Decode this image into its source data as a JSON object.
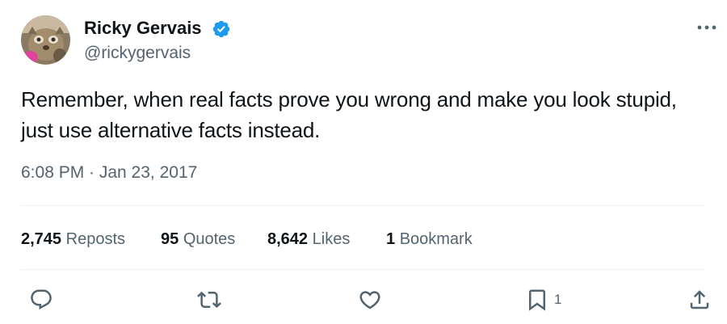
{
  "author": {
    "name": "Ricky Gervais",
    "handle": "@rickygervais",
    "verified_icon": "verified-badge-icon",
    "verified_color": "#1d9bf0"
  },
  "tweet": {
    "text_lines": [
      "Remember, when real facts prove you wrong and make you look stupid,",
      "just use alternative facts instead."
    ],
    "timestamp": "6:08 PM · Jan 23, 2017"
  },
  "stats": {
    "reposts": {
      "count": "2,745",
      "label": "Reposts"
    },
    "quotes": {
      "count": "95",
      "label": "Quotes"
    },
    "likes": {
      "count": "8,642",
      "label": "Likes"
    },
    "bookmarks": {
      "count": "1",
      "label": "Bookmark"
    }
  },
  "actions": {
    "reply": {
      "icon": "reply-icon"
    },
    "repost": {
      "icon": "repost-icon"
    },
    "like": {
      "icon": "heart-icon"
    },
    "bookmark": {
      "icon": "bookmark-icon",
      "count": "1"
    },
    "share": {
      "icon": "share-icon"
    }
  },
  "colors": {
    "text_primary": "#0f1419",
    "text_secondary": "#536471",
    "divider": "#eff3f4"
  }
}
